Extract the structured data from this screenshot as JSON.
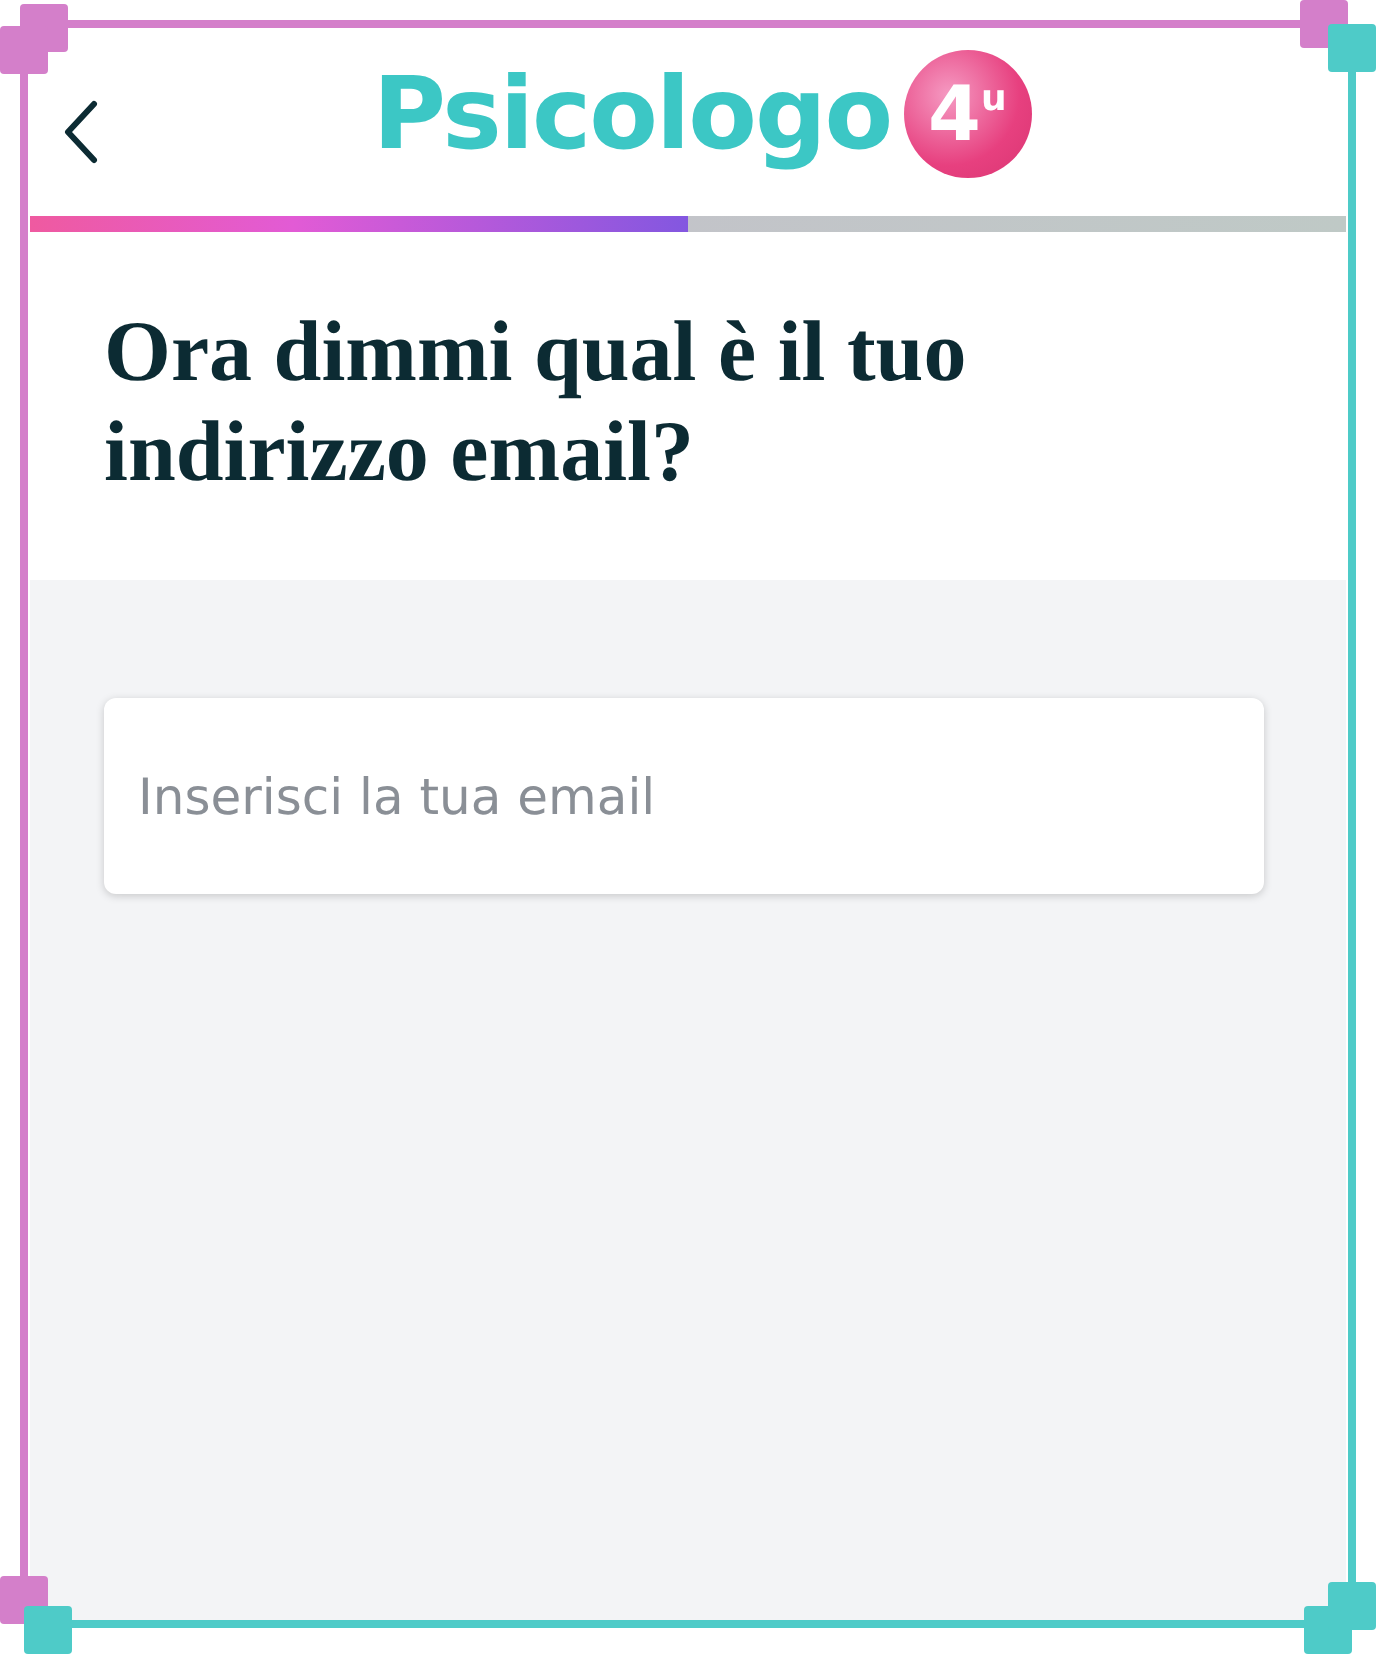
{
  "header": {
    "logo": {
      "name": "Psicologo",
      "badge": "4",
      "badge_sup": "u"
    }
  },
  "progress": {
    "level": 0.5
  },
  "question": "Ora dimmi qual è il tuo indirizzo email?",
  "email_field": {
    "placeholder": "Inserisci la tua email"
  }
}
